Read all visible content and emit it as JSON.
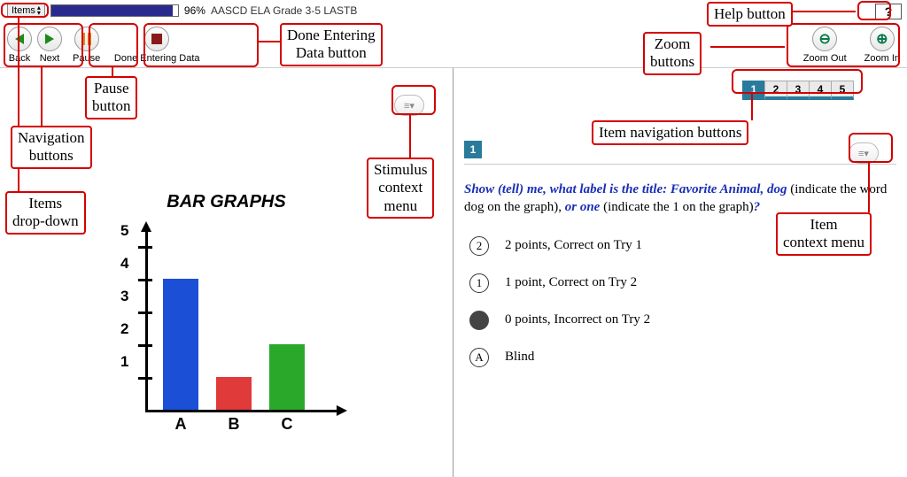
{
  "topbar": {
    "items_dropdown_label": "Items",
    "progress_pct": "96%",
    "test_title": "AASCD ELA Grade 3-5 LASTB"
  },
  "toolbar": {
    "back": "Back",
    "next": "Next",
    "pause": "Pause",
    "done": "Done Entering Data",
    "zoom_out": "Zoom Out",
    "zoom_in": "Zoom In"
  },
  "help_glyph": "?",
  "item_tabs": [
    "1",
    "2",
    "3",
    "4",
    "5"
  ],
  "stimulus": {
    "title": "BAR GRAPHS"
  },
  "question": {
    "number": "1",
    "prompt_parts": {
      "a": "Show (tell) me, what label is the title: Favorite Animal, dog",
      "b": " (indicate the word dog on the graph), ",
      "c": "or one",
      "d": " (indicate the 1 on the graph)",
      "e": "?"
    },
    "options": [
      {
        "bullet": "2",
        "text": "2 points, Correct on Try 1"
      },
      {
        "bullet": "1",
        "text": "1 point, Correct on Try 2"
      },
      {
        "bullet": "",
        "text": "0 points, Incorrect on Try 2"
      },
      {
        "bullet": "A",
        "text": "Blind"
      }
    ]
  },
  "callouts": {
    "help_button": "Help button",
    "zoom_buttons": "Zoom\nbuttons",
    "done_button": "Done Entering\nData button",
    "pause_button": "Pause\nbutton",
    "nav_buttons": "Navigation\nbuttons",
    "items_dd": "Items\ndrop-down",
    "stim_ctx": "Stimulus\ncontext\nmenu",
    "item_nav": "Item navigation buttons",
    "item_ctx": "Item\ncontext menu"
  },
  "chart_data": {
    "type": "bar",
    "title": "BAR GRAPHS",
    "categories": [
      "A",
      "B",
      "C"
    ],
    "values": [
      4,
      1,
      2
    ],
    "colors": [
      "#1a4fd6",
      "#e03a3a",
      "#2aa82a"
    ],
    "ylim": [
      0,
      5
    ],
    "yticks": [
      1,
      2,
      3,
      4,
      5
    ],
    "xlabel": "",
    "ylabel": ""
  }
}
